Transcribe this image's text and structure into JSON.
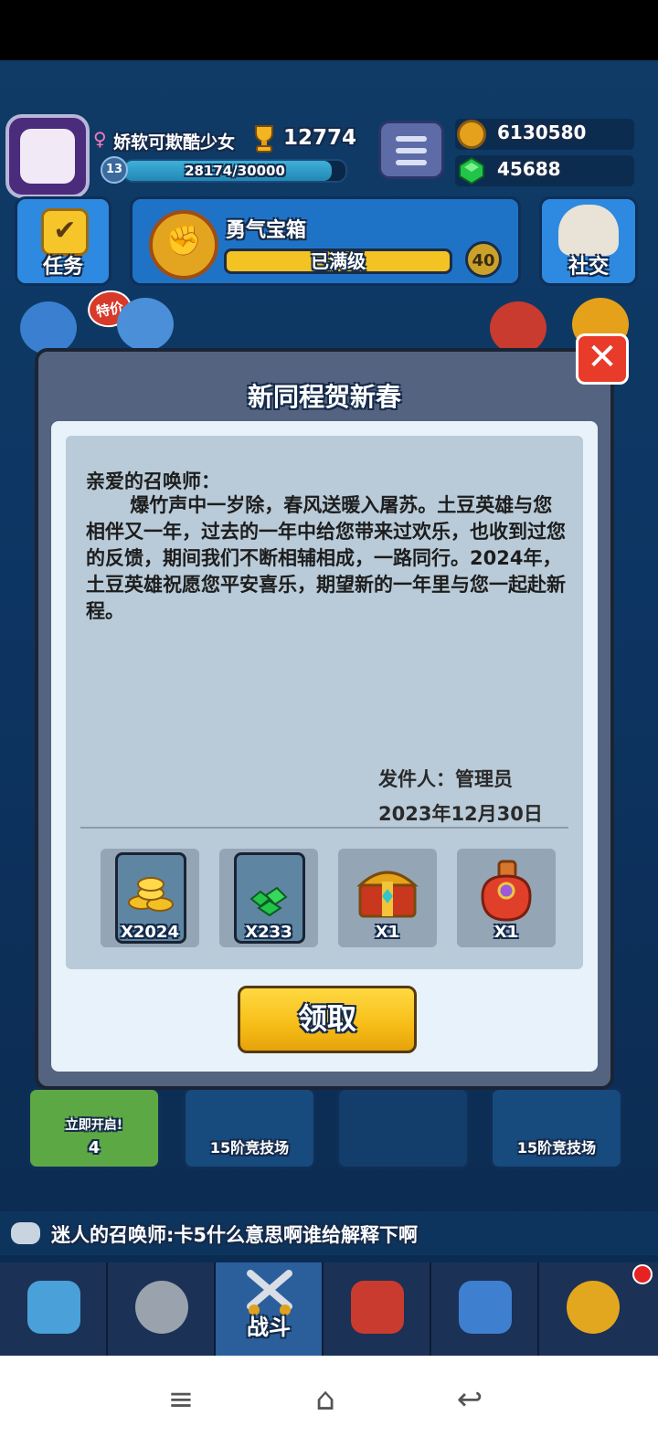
{
  "player": {
    "name": "娇软可欺酷少女",
    "level": "13",
    "trophies": "12774",
    "xp_text": "28174/30000",
    "xp_fraction": 0.939
  },
  "resources": {
    "coins": "6130580",
    "gems": "45688"
  },
  "top_buttons": {
    "tasks_label": "任务",
    "social_label": "社交"
  },
  "courage_chest": {
    "title": "勇气宝箱",
    "status": "已满级",
    "level": "40"
  },
  "promo_badge": "特价",
  "modal": {
    "title": "新同程贺新春",
    "greeting": "亲爱的召唤师：",
    "message": "爆竹声中一岁除，春风送暖入屠苏。土豆英雄与您相伴又一年，过去的一年中给您带来过欢乐，也收到过您的反馈，期间我们不断相辅相成，一路同行。2024年，土豆英雄祝愿您平安喜乐，期望新的一年里与您一起赴新程。",
    "sender": "发件人：管理员",
    "date": "2023年12月30日",
    "rewards": [
      {
        "name": "coins",
        "qty": "X2024"
      },
      {
        "name": "gems",
        "qty": "X233"
      },
      {
        "name": "treasure-chest",
        "qty": "X1"
      },
      {
        "name": "red-bag",
        "qty": "X1"
      }
    ],
    "claim_label": "领取"
  },
  "chest_slots": {
    "open_now": "立即开启!",
    "open_cost": "4",
    "arena_label": "15阶竞技场"
  },
  "chat": {
    "message": "迷人的召唤师:卡5什么意思啊谁给解释下啊"
  },
  "tabs": {
    "battle_label": "战斗"
  },
  "colors": {
    "background": "#0f3b66",
    "gold_button": "#f7bd16",
    "close_red": "#e93b2a",
    "gem_green": "#22c44a"
  }
}
